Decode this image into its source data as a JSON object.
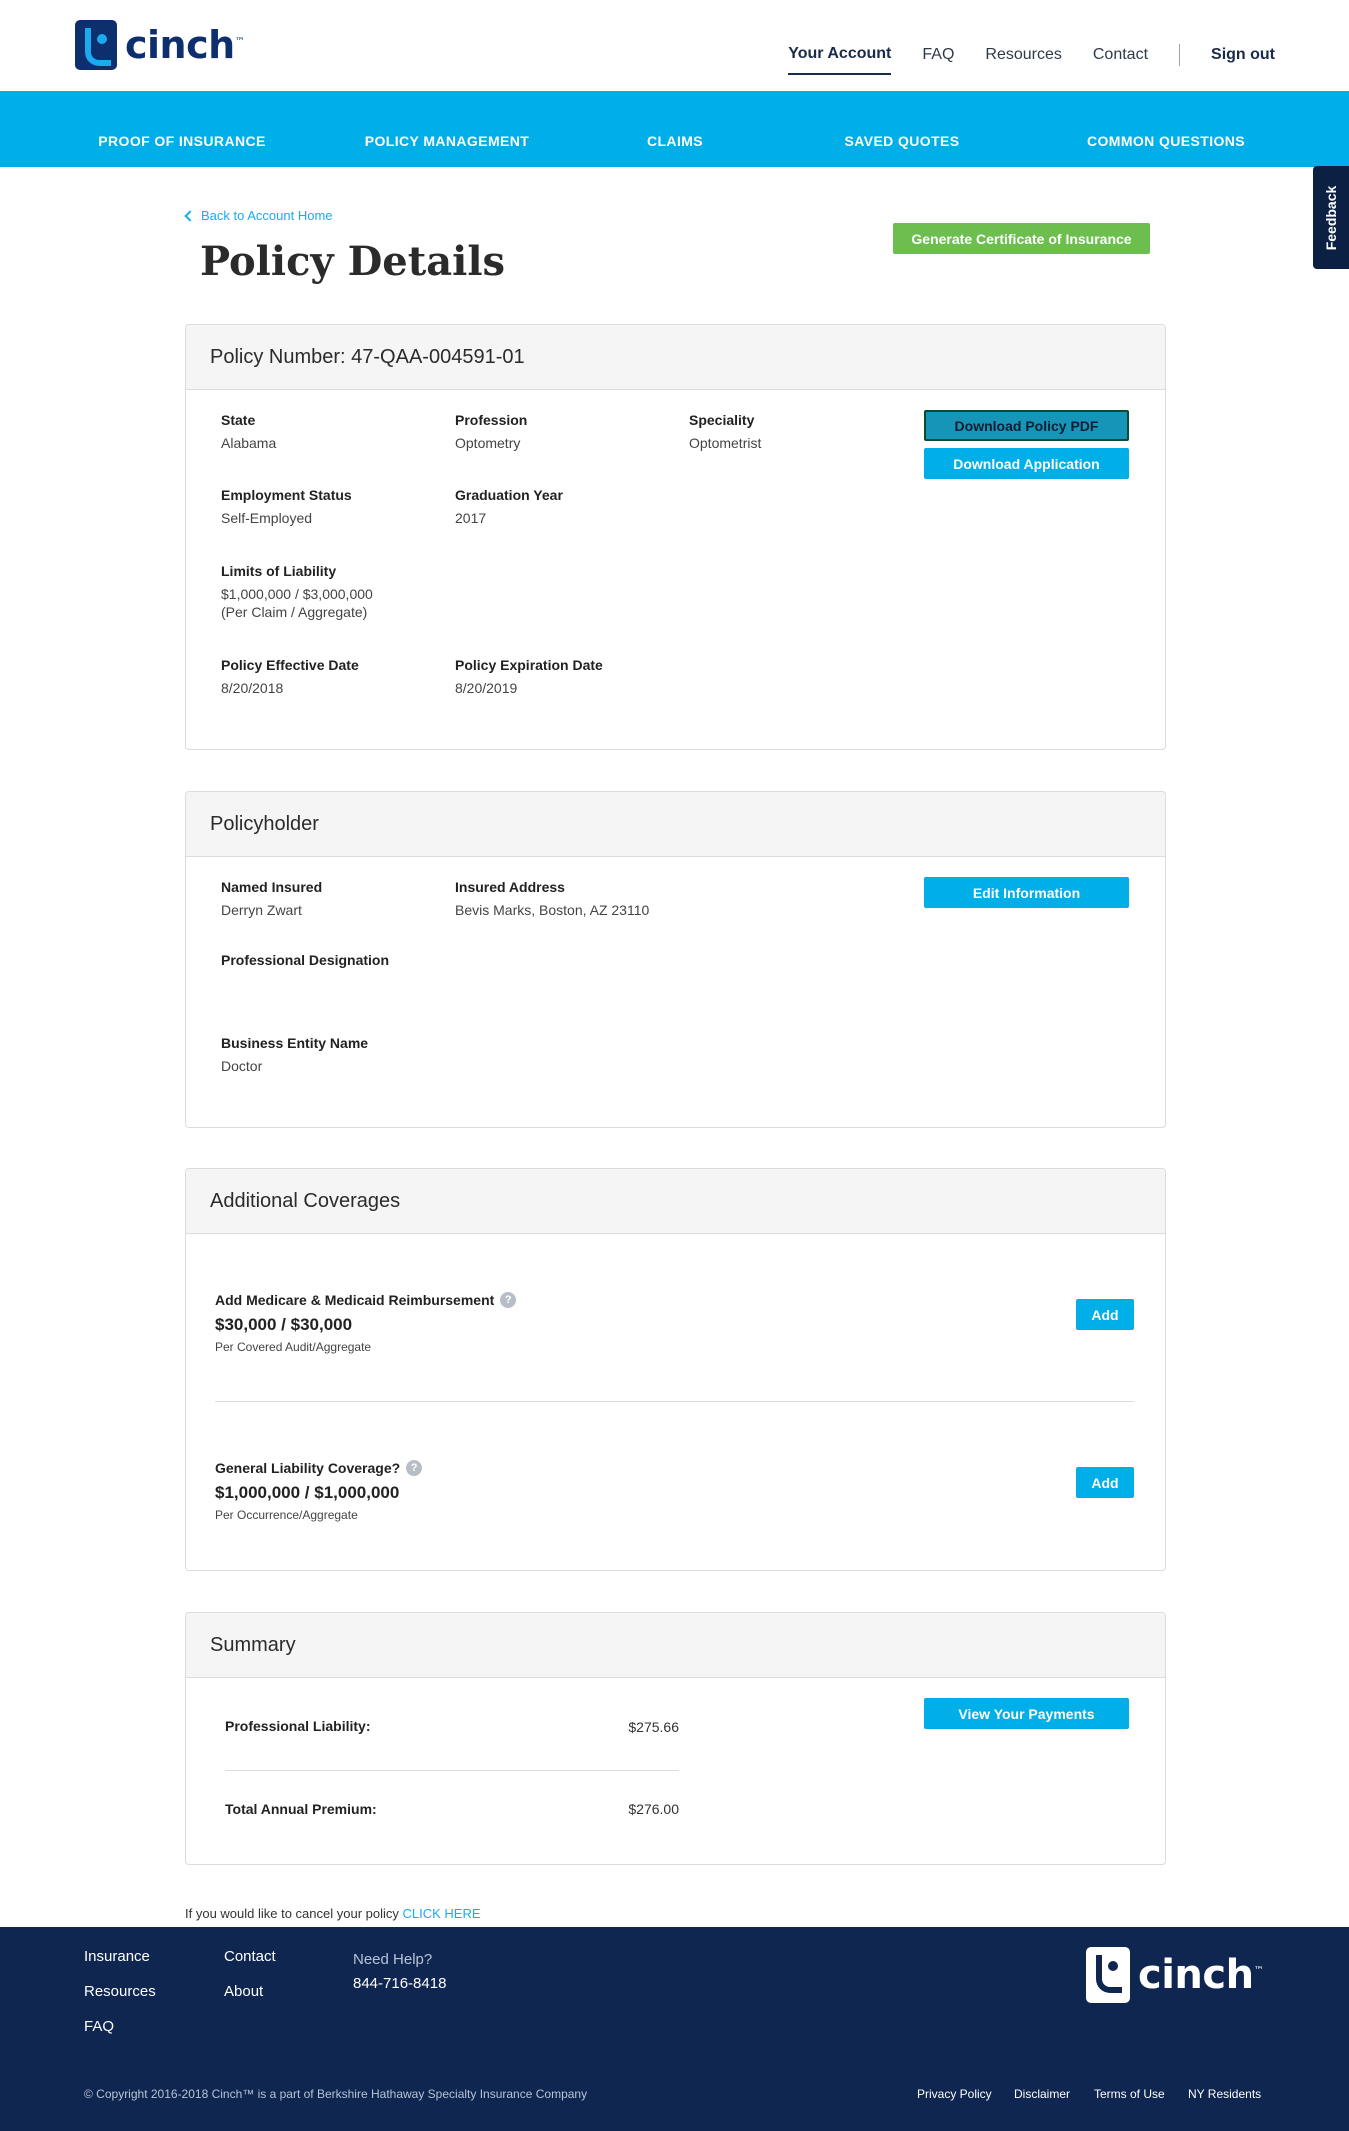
{
  "brand": {
    "name": "cinch",
    "tm": "™"
  },
  "topnav": {
    "items": [
      "Your Account",
      "FAQ",
      "Resources",
      "Contact"
    ],
    "signout": "Sign out"
  },
  "mainnav": [
    "PROOF OF INSURANCE",
    "POLICY MANAGEMENT",
    "CLAIMS",
    "SAVED QUOTES",
    "COMMON QUESTIONS"
  ],
  "feedback": "Feedback",
  "page": {
    "back_link": "Back to Account Home",
    "title": "Policy Details",
    "certificate_button": "Generate Certificate of Insurance"
  },
  "policy": {
    "header": "Policy Number: 47-QAA-004591-01",
    "fields": {
      "state": {
        "label": "State",
        "value": "Alabama"
      },
      "profession": {
        "label": "Profession",
        "value": "Optometry"
      },
      "speciality": {
        "label": "Speciality",
        "value": "Optometrist"
      },
      "employment": {
        "label": "Employment Status",
        "value": "Self-Employed"
      },
      "graduation": {
        "label": "Graduation Year",
        "value": "2017"
      },
      "limits": {
        "label": "Limits of Liability",
        "value": "$1,000,000 / $3,000,000",
        "note": "(Per Claim / Aggregate)"
      },
      "effective": {
        "label": "Policy Effective Date",
        "value": "8/20/2018"
      },
      "expiration": {
        "label": "Policy Expiration Date",
        "value": "8/20/2019"
      }
    },
    "download_pdf": "Download Policy PDF",
    "download_app": "Download Application"
  },
  "policyholder": {
    "header": "Policyholder",
    "named_insured": {
      "label": "Named Insured",
      "value": "Derryn Zwart"
    },
    "address": {
      "label": "Insured Address",
      "value": "Bevis Marks, Boston, AZ 23110"
    },
    "designation": {
      "label": "Professional Designation",
      "value": ""
    },
    "business": {
      "label": "Business Entity Name",
      "value": "Doctor"
    },
    "edit_button": "Edit Information"
  },
  "coverages": {
    "header": "Additional Coverages",
    "items": [
      {
        "title": "Add Medicare & Medicaid Reimbursement",
        "amount": "$30,000 / $30,000",
        "sub": "Per Covered Audit/Aggregate",
        "button": "Add"
      },
      {
        "title": "General Liability Coverage?",
        "amount": "$1,000,000 / $1,000,000",
        "sub": "Per Occurrence/Aggregate",
        "button": "Add"
      }
    ],
    "help_glyph": "?"
  },
  "summary": {
    "header": "Summary",
    "rows": [
      {
        "label": "Professional Liability:",
        "value": "$275.66"
      },
      {
        "label": "Total Annual Premium:",
        "value": "$276.00"
      }
    ],
    "payments_button": "View Your Payments"
  },
  "cancel": {
    "text": "If you would like to cancel your policy",
    "link": "CLICK HERE"
  },
  "footer": {
    "links_col1": [
      "Insurance",
      "Resources",
      "FAQ"
    ],
    "links_col2": [
      "Contact",
      "About"
    ],
    "need_help": "Need Help?",
    "phone": "844-716-8418",
    "copyright": "© Copyright 2016-2018 Cinch™ is a part of Berkshire Hathaway Specialty Insurance Company",
    "legal": [
      "Privacy Policy",
      "Disclaimer",
      "Terms of Use",
      "NY Residents"
    ]
  },
  "colors": {
    "accent": "#00aee8",
    "navy": "#0f2650",
    "green": "#6cbf4e"
  }
}
